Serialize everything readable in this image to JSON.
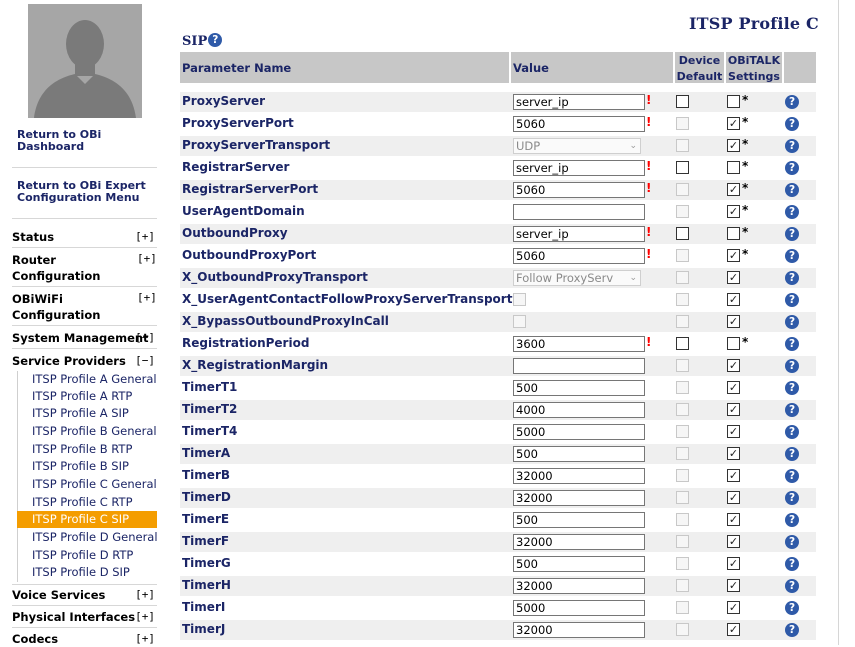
{
  "sidebar": {
    "return_dashboard": "Return to OBi Dashboard",
    "return_expert": "Return to OBi Expert Configuration Menu",
    "sections": [
      {
        "label": "Status",
        "toggle": "[+]"
      },
      {
        "label": "Router Configuration",
        "toggle": "[+]"
      },
      {
        "label": "OBiWiFi Configuration",
        "toggle": "[+]"
      },
      {
        "label": "System Management",
        "toggle": "[+]"
      },
      {
        "label": "Service Providers",
        "toggle": "[−]"
      },
      {
        "label": "Voice Services",
        "toggle": "[+]"
      },
      {
        "label": "Physical Interfaces",
        "toggle": "[+]"
      },
      {
        "label": "Codecs",
        "toggle": "[+]"
      }
    ],
    "service_provider_items": [
      "ITSP Profile A General",
      "ITSP Profile A RTP",
      "ITSP Profile A SIP",
      "ITSP Profile B General",
      "ITSP Profile B RTP",
      "ITSP Profile B SIP",
      "ITSP Profile C General",
      "ITSP Profile C RTP",
      "ITSP Profile C SIP",
      "ITSP Profile D General",
      "ITSP Profile D RTP",
      "ITSP Profile D SIP"
    ],
    "active_item": "ITSP Profile C SIP"
  },
  "page": {
    "title": "ITSP Profile C",
    "section": "SIP",
    "help_glyph": "?"
  },
  "table": {
    "headers": {
      "parameter": "Parameter Name",
      "value": "Value",
      "device_default_1": "Device",
      "device_default_2": "Default",
      "obitalk_1": "OBiTALK",
      "obitalk_2": "Settings"
    },
    "rows": [
      {
        "name": "ProxyServer",
        "type": "text",
        "value": "server_ip",
        "required": true,
        "dd": "empty",
        "ob": "empty",
        "star": true
      },
      {
        "name": "ProxyServerPort",
        "type": "text",
        "value": "5060",
        "required": true,
        "dd": "disabled",
        "ob": "checked",
        "star": true
      },
      {
        "name": "ProxyServerTransport",
        "type": "select",
        "value": "UDP",
        "required": false,
        "dd": "disabled",
        "ob": "checked",
        "star": true
      },
      {
        "name": "RegistrarServer",
        "type": "text",
        "value": "server_ip",
        "required": true,
        "dd": "empty",
        "ob": "empty",
        "star": true
      },
      {
        "name": "RegistrarServerPort",
        "type": "text",
        "value": "5060",
        "required": true,
        "dd": "disabled",
        "ob": "checked",
        "star": true
      },
      {
        "name": "UserAgentDomain",
        "type": "text",
        "value": "",
        "required": false,
        "dd": "disabled",
        "ob": "checked",
        "star": true
      },
      {
        "name": "OutboundProxy",
        "type": "text",
        "value": "server_ip",
        "required": true,
        "dd": "empty",
        "ob": "empty",
        "star": true
      },
      {
        "name": "OutboundProxyPort",
        "type": "text",
        "value": "5060",
        "required": true,
        "dd": "disabled",
        "ob": "checked",
        "star": true
      },
      {
        "name": "X_OutboundProxyTransport",
        "type": "select",
        "value": "Follow ProxyServ",
        "required": false,
        "dd": "disabled",
        "ob": "checked",
        "star": false
      },
      {
        "name": "X_UserAgentContactFollowProxyServerTransport",
        "type": "checkbox",
        "value": "",
        "required": false,
        "dd": "disabled",
        "ob": "checked",
        "star": false
      },
      {
        "name": "X_BypassOutboundProxyInCall",
        "type": "checkbox",
        "value": "",
        "required": false,
        "dd": "disabled",
        "ob": "checked",
        "star": false
      },
      {
        "name": "RegistrationPeriod",
        "type": "text",
        "value": "3600",
        "required": true,
        "dd": "empty",
        "ob": "empty",
        "star": true
      },
      {
        "name": "X_RegistrationMargin",
        "type": "text",
        "value": "",
        "required": false,
        "dd": "disabled",
        "ob": "checked",
        "star": false
      },
      {
        "name": "TimerT1",
        "type": "text",
        "value": "500",
        "required": false,
        "dd": "disabled",
        "ob": "checked",
        "star": false
      },
      {
        "name": "TimerT2",
        "type": "text",
        "value": "4000",
        "required": false,
        "dd": "disabled",
        "ob": "checked",
        "star": false
      },
      {
        "name": "TimerT4",
        "type": "text",
        "value": "5000",
        "required": false,
        "dd": "disabled",
        "ob": "checked",
        "star": false
      },
      {
        "name": "TimerA",
        "type": "text",
        "value": "500",
        "required": false,
        "dd": "disabled",
        "ob": "checked",
        "star": false
      },
      {
        "name": "TimerB",
        "type": "text",
        "value": "32000",
        "required": false,
        "dd": "disabled",
        "ob": "checked",
        "star": false
      },
      {
        "name": "TimerD",
        "type": "text",
        "value": "32000",
        "required": false,
        "dd": "disabled",
        "ob": "checked",
        "star": false
      },
      {
        "name": "TimerE",
        "type": "text",
        "value": "500",
        "required": false,
        "dd": "disabled",
        "ob": "checked",
        "star": false
      },
      {
        "name": "TimerF",
        "type": "text",
        "value": "32000",
        "required": false,
        "dd": "disabled",
        "ob": "checked",
        "star": false
      },
      {
        "name": "TimerG",
        "type": "text",
        "value": "500",
        "required": false,
        "dd": "disabled",
        "ob": "checked",
        "star": false
      },
      {
        "name": "TimerH",
        "type": "text",
        "value": "32000",
        "required": false,
        "dd": "disabled",
        "ob": "checked",
        "star": false
      },
      {
        "name": "TimerI",
        "type": "text",
        "value": "5000",
        "required": false,
        "dd": "disabled",
        "ob": "checked",
        "star": false
      },
      {
        "name": "TimerJ",
        "type": "text",
        "value": "32000",
        "required": false,
        "dd": "disabled",
        "ob": "checked",
        "star": false
      }
    ]
  },
  "colors": {
    "accent_active": "#f49d00",
    "link_navy": "#1b2566",
    "required_mark": "#ff0000",
    "help_icon": "#2f5aa8",
    "header_bg": "#c7c7c7"
  }
}
